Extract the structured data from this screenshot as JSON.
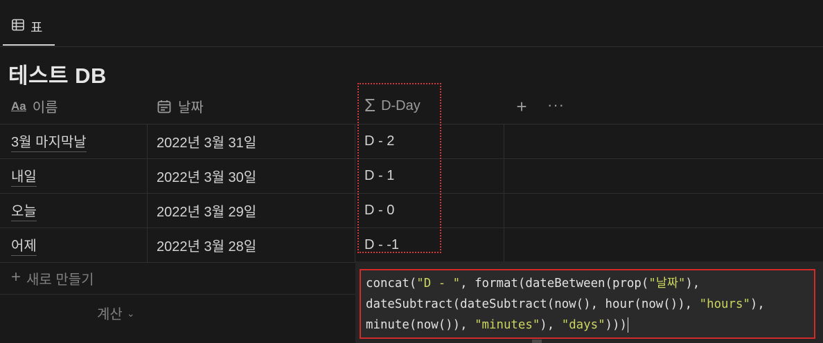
{
  "tabs": [
    {
      "label": "표",
      "icon": "table-icon",
      "active": true
    }
  ],
  "database": {
    "title": "테스트 DB"
  },
  "columns": [
    {
      "label": "이름",
      "icon": "text-property-icon",
      "icon_text": "Aa"
    },
    {
      "label": "날짜",
      "icon": "calendar-icon"
    },
    {
      "label": "D-Day",
      "icon": "sigma-formula-icon",
      "icon_text": "Σ"
    }
  ],
  "header_actions": {
    "add_property": "+",
    "more": "···"
  },
  "rows": [
    {
      "name": "3월 마지막날",
      "date": "2022년 3월 31일",
      "dday": "D - 2"
    },
    {
      "name": "내일",
      "date": "2022년 3월 30일",
      "dday": "D - 1"
    },
    {
      "name": "오늘",
      "date": "2022년 3월 29일",
      "dday": "D - 0"
    },
    {
      "name": "어제",
      "date": "2022년 3월 28일",
      "dday": "D - -1"
    }
  ],
  "new_row": {
    "plus": "+",
    "label": "새로 만들기"
  },
  "calculate": {
    "label": "계산",
    "chevron": "⌄"
  },
  "formula": {
    "line1_a": "concat(",
    "line1_s1": "\"D - \"",
    "line1_b": ", format(dateBetween(prop(",
    "line1_s2": "\"날짜\"",
    "line1_c": "),",
    "line2_a": "dateSubtract(dateSubtract(now(), hour(now()), ",
    "line2_s1": "\"hours\"",
    "line2_b": "),",
    "line3_a": "minute(now()), ",
    "line3_s1": "\"minutes\"",
    "line3_b": "), ",
    "line3_s2": "\"days\"",
    "line3_c": ")))"
  },
  "colors": {
    "background": "#191919",
    "text": "#d4d4d4",
    "muted": "#9b9b9b",
    "string_literal": "#cbd560",
    "highlight_red": "#d42a2a"
  }
}
